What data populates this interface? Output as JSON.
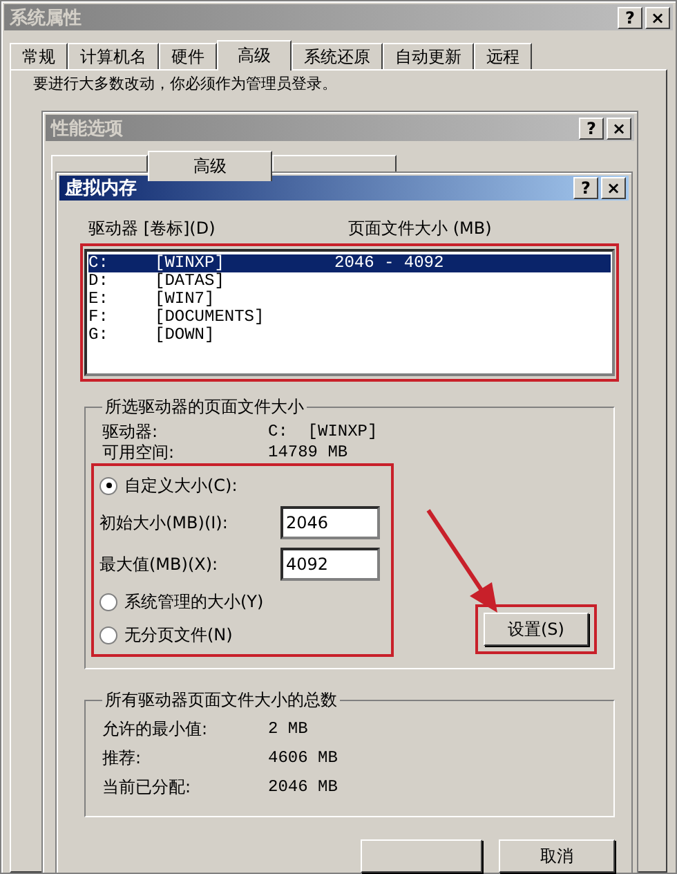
{
  "system_properties": {
    "title": "系统属性",
    "title_buttons": [
      "?",
      "×"
    ],
    "tabs": [
      {
        "label": "常规",
        "selected": false
      },
      {
        "label": "计算机名",
        "selected": false
      },
      {
        "label": "硬件",
        "selected": false
      },
      {
        "label": "高级",
        "selected": true
      },
      {
        "label": "系统还原",
        "selected": false
      },
      {
        "label": "自动更新",
        "selected": false
      },
      {
        "label": "远程",
        "selected": false
      }
    ],
    "notice": "要进行大多数改动，你必须作为管理员登录。"
  },
  "performance_options": {
    "title": "性能选项",
    "title_buttons": [
      "?",
      "×"
    ],
    "tabs": [
      {
        "selected": false
      },
      {
        "label": "高级",
        "selected": true
      },
      {
        "selected": false
      }
    ]
  },
  "virtual_memory": {
    "title": "虚拟内存",
    "title_buttons": [
      "?",
      "×"
    ],
    "columns": [
      "驱动器 [卷标](D)",
      "页面文件大小 (MB)"
    ],
    "drives": [
      {
        "letter": "C:",
        "label": "[WINXP]",
        "size": "2046 - 4092",
        "selected": true
      },
      {
        "letter": "D:",
        "label": "[DATAS]",
        "selected": false
      },
      {
        "letter": "E:",
        "label": "[WIN7]",
        "selected": false
      },
      {
        "letter": "F:",
        "label": "[DOCUMENTS]",
        "selected": false
      },
      {
        "letter": "G:",
        "label": "[DOWN]",
        "selected": false
      }
    ],
    "selected_drive": {
      "title": "所选驱动器的页面文件大小",
      "rows": [
        {
          "label": "驱动器:",
          "value": "C:  [WINXP]"
        },
        {
          "label": "可用空间:",
          "value": "14789 MB"
        }
      ]
    },
    "options": [
      {
        "kind": "radio",
        "label": "自定义大小(C):",
        "selected": true
      },
      {
        "kind": "field",
        "label": "初始大小(MB)(I):",
        "value": "2046"
      },
      {
        "kind": "field",
        "label": "最大值(MB)(X):",
        "value": "4092"
      },
      {
        "kind": "radio",
        "label": "系统管理的大小(Y)",
        "selected": false
      },
      {
        "kind": "radio",
        "label": "无分页文件(N)",
        "selected": false
      }
    ],
    "set_button": "设置(S)",
    "totals": {
      "title": "所有驱动器页面文件大小的总数",
      "rows": [
        {
          "label": "允许的最小值:",
          "value": "2 MB"
        },
        {
          "label": "推荐:",
          "value": "4606 MB"
        },
        {
          "label": "当前已分配:",
          "value": "2046 MB"
        }
      ]
    },
    "cancel_button": "取消"
  }
}
